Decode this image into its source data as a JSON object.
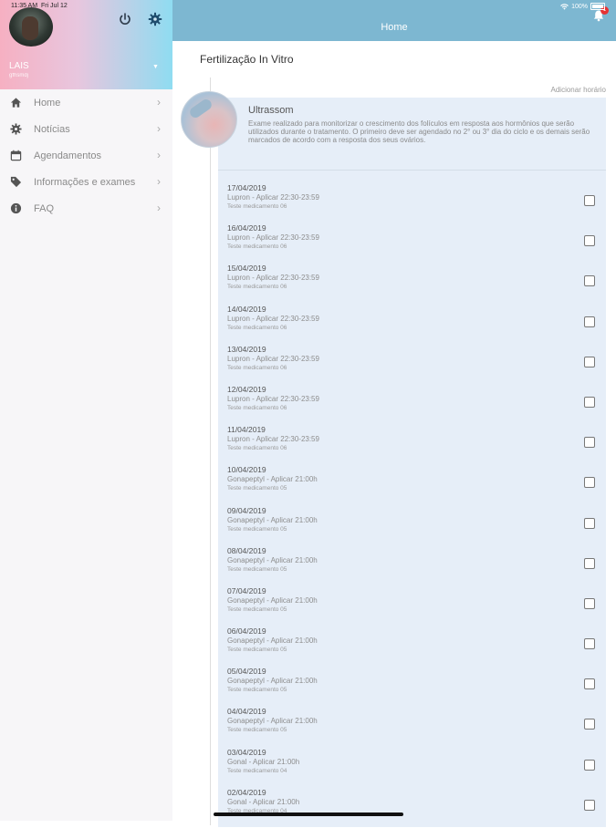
{
  "status_bar": {
    "time": "11:35 AM",
    "date": "Fri Jul 12",
    "battery": "100%"
  },
  "sidebar": {
    "user_name": "LAIS",
    "user_sub": "gfhsmdj",
    "items": [
      {
        "label": "Home",
        "icon": "home-icon"
      },
      {
        "label": "Notícias",
        "icon": "news-icon"
      },
      {
        "label": "Agendamentos",
        "icon": "calendar-icon"
      },
      {
        "label": "Informações e exames",
        "icon": "tag-icon"
      },
      {
        "label": "FAQ",
        "icon": "info-icon"
      }
    ]
  },
  "topbar": {
    "title": "Home",
    "badge": "1"
  },
  "main": {
    "title": "Fertilização In Vitro",
    "add_time": "Adicionar horário",
    "card": {
      "title": "Ultrassom",
      "description": "Exame realizado para monitorizar o crescimento dos folículos em resposta aos hormônios que serão utilizados durante o tratamento. O primeiro deve ser agendado no 2° ou 3° dia do ciclo e os demais serão marcados de acordo com a resposta dos seus ovários."
    },
    "entries": [
      {
        "date": "17/04/2019",
        "line": "Lupron - Aplicar 22:30-23:59",
        "sub": "Teste medicamento 06"
      },
      {
        "date": "16/04/2019",
        "line": "Lupron - Aplicar 22:30-23:59",
        "sub": "Teste medicamento 06"
      },
      {
        "date": "15/04/2019",
        "line": "Lupron - Aplicar 22:30-23:59",
        "sub": "Teste medicamento 06"
      },
      {
        "date": "14/04/2019",
        "line": "Lupron - Aplicar 22:30-23:59",
        "sub": "Teste medicamento 06"
      },
      {
        "date": "13/04/2019",
        "line": "Lupron - Aplicar 22:30-23:59",
        "sub": "Teste medicamento 06"
      },
      {
        "date": "12/04/2019",
        "line": "Lupron - Aplicar 22:30-23:59",
        "sub": "Teste medicamento 06"
      },
      {
        "date": "11/04/2019",
        "line": "Lupron - Aplicar 22:30-23:59",
        "sub": "Teste medicamento 06"
      },
      {
        "date": "10/04/2019",
        "line": "Gonapeptyl - Aplicar 21:00h",
        "sub": "Teste medicamento 05"
      },
      {
        "date": "09/04/2019",
        "line": "Gonapeptyl - Aplicar 21:00h",
        "sub": "Teste medicamento 05"
      },
      {
        "date": "08/04/2019",
        "line": "Gonapeptyl - Aplicar 21:00h",
        "sub": "Teste medicamento 05"
      },
      {
        "date": "07/04/2019",
        "line": "Gonapeptyl - Aplicar 21:00h",
        "sub": "Teste medicamento 05"
      },
      {
        "date": "06/04/2019",
        "line": "Gonapeptyl - Aplicar 21:00h",
        "sub": "Teste medicamento 05"
      },
      {
        "date": "05/04/2019",
        "line": "Gonapeptyl - Aplicar 21:00h",
        "sub": "Teste medicamento 05"
      },
      {
        "date": "04/04/2019",
        "line": "Gonapeptyl - Aplicar 21:00h",
        "sub": "Teste medicamento 05"
      },
      {
        "date": "03/04/2019",
        "line": "Gonal - Aplicar 21:00h",
        "sub": "Teste medicamento 04"
      },
      {
        "date": "02/04/2019",
        "line": "Gonal - Aplicar 21:00h",
        "sub": "Teste medicamento 04"
      }
    ]
  }
}
